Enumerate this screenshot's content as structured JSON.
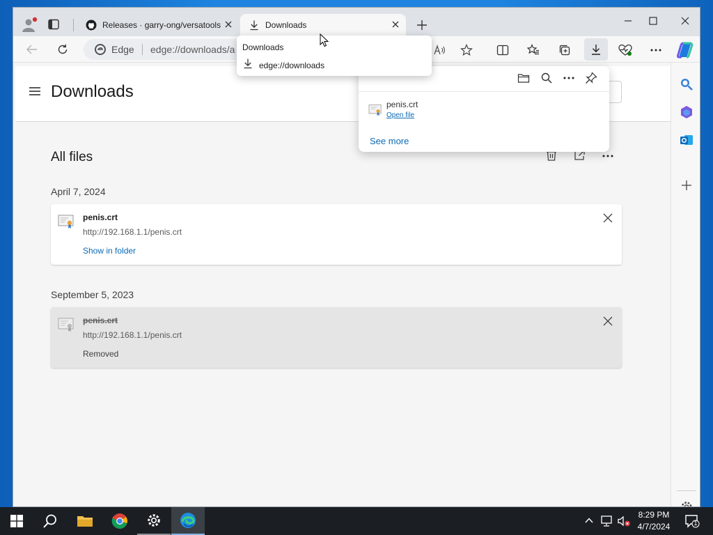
{
  "browser": {
    "tabs": [
      {
        "label": "Releases · garry-ong/versatools",
        "active": false
      },
      {
        "label": "Downloads",
        "active": true
      }
    ],
    "address": {
      "site_label": "Edge",
      "url": "edge://downloads/a"
    },
    "tooltip": {
      "title": "Downloads",
      "url": "edge://downloads"
    }
  },
  "page": {
    "title": "Downloads",
    "section_title": "All files",
    "groups": [
      {
        "date": "April 7, 2024",
        "item": {
          "filename": "penis.crt",
          "url": "http://192.168.1.1/penis.crt",
          "action": "Show in folder",
          "removed": false
        }
      },
      {
        "date": "September 5, 2023",
        "item": {
          "filename": "penis.crt",
          "url": "http://192.168.1.1/penis.crt",
          "action": "Removed",
          "removed": true
        }
      }
    ]
  },
  "flyout": {
    "file_name": "penis.crt",
    "open_label": "Open file",
    "see_more": "See more"
  },
  "taskbar": {
    "time": "8:29 PM",
    "date": "4/7/2024",
    "notification_count": "1"
  },
  "colors": {
    "accent_link": "#0b6ab5",
    "profile_dot": "#d13438"
  }
}
